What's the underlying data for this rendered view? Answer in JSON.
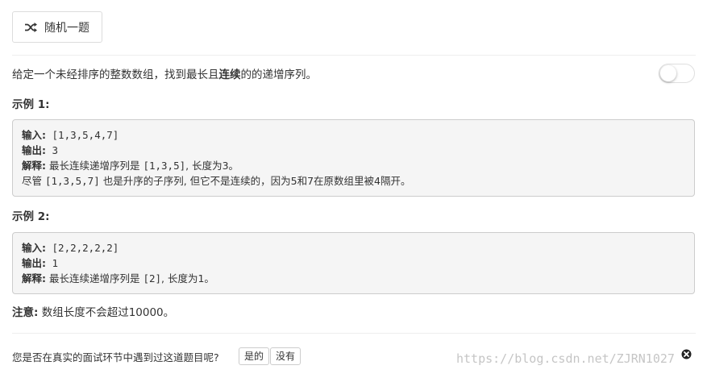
{
  "header": {
    "random_button_label": "随机一题",
    "random_icon": "shuffle-icon"
  },
  "problem": {
    "desc_before": "给定一个未经排序的整数数组，找到最长且",
    "desc_bold": "连续",
    "desc_after": "的的递增序列。",
    "toggle_on": false
  },
  "examples": [
    {
      "title": "示例 1:",
      "input_label": "输入:",
      "input_value": " [1,3,5,4,7]",
      "output_label": "输出:",
      "output_value": " 3",
      "explain_label": "解释:",
      "explain_text_1": " 最长连续递增序列是 ",
      "explain_code_1": "[1,3,5]",
      "explain_text_2": ", 长度为3。",
      "extra_text_1": "尽管 ",
      "extra_code": "[1,3,5,7]",
      "extra_text_2": " 也是升序的子序列, 但它不是连续的，因为5和7在原数组里被4隔开。"
    },
    {
      "title": "示例 2:",
      "input_label": "输入:",
      "input_value": " [2,2,2,2,2]",
      "output_label": "输出:",
      "output_value": " 1",
      "explain_label": "解释:",
      "explain_text_1": " 最长连续递增序列是 ",
      "explain_code_1": "[2]",
      "explain_text_2": ", 长度为1。"
    }
  ],
  "note": {
    "label": "注意:",
    "text": " 数组长度不会超过10000。"
  },
  "feedback": {
    "question": "您是否在真实的面试环节中遇到过这道题目呢?",
    "yes_label": "是的",
    "no_label": "没有"
  },
  "watermark": "https://blog.csdn.net/ZJRN1027",
  "close_icon": "close-icon"
}
